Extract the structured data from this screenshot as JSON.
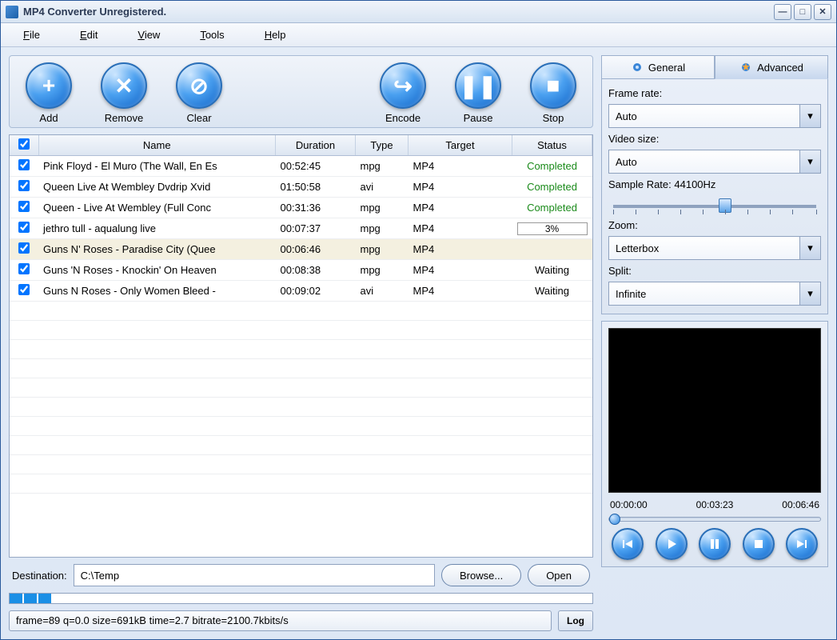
{
  "window": {
    "title": "MP4 Converter Unregistered."
  },
  "menu": {
    "file": "File",
    "edit": "Edit",
    "view": "View",
    "tools": "Tools",
    "help": "Help"
  },
  "toolbar": {
    "add": "Add",
    "remove": "Remove",
    "clear": "Clear",
    "encode": "Encode",
    "pause": "Pause",
    "stop": "Stop"
  },
  "table": {
    "headers": {
      "name": "Name",
      "duration": "Duration",
      "type": "Type",
      "target": "Target",
      "status": "Status"
    },
    "rows": [
      {
        "name": "Pink Floyd - El Muro (The Wall, En Es",
        "duration": "00:52:45",
        "type": "mpg",
        "target": "MP4",
        "status": "Completed",
        "status_kind": "complete"
      },
      {
        "name": "Queen Live At Wembley Dvdrip Xvid",
        "duration": "01:50:58",
        "type": "avi",
        "target": "MP4",
        "status": "Completed",
        "status_kind": "complete"
      },
      {
        "name": "Queen - Live At Wembley (Full Conc",
        "duration": "00:31:36",
        "type": "mpg",
        "target": "MP4",
        "status": "Completed",
        "status_kind": "complete"
      },
      {
        "name": "jethro tull - aqualung live",
        "duration": "00:07:37",
        "type": "mpg",
        "target": "MP4",
        "status": "3%",
        "status_kind": "progress"
      },
      {
        "name": "Guns N' Roses - Paradise City (Quee",
        "duration": "00:06:46",
        "type": "mpg",
        "target": "MP4",
        "status": "",
        "status_kind": "selected"
      },
      {
        "name": "Guns 'N Roses - Knockin' On Heaven",
        "duration": "00:08:38",
        "type": "mpg",
        "target": "MP4",
        "status": "Waiting",
        "status_kind": "waiting"
      },
      {
        "name": "Guns N Roses - Only Women Bleed -",
        "duration": "00:09:02",
        "type": "avi",
        "target": "MP4",
        "status": "Waiting",
        "status_kind": "waiting"
      }
    ]
  },
  "destination": {
    "label": "Destination:",
    "path": "C:\\Temp",
    "browse": "Browse...",
    "open": "Open"
  },
  "status": {
    "text": "frame=89 q=0.0 size=691kB time=2.7 bitrate=2100.7kbits/s",
    "log": "Log"
  },
  "tabs": {
    "general": "General",
    "advanced": "Advanced"
  },
  "options": {
    "frame_rate_label": "Frame rate:",
    "frame_rate_value": "Auto",
    "video_size_label": "Video size:",
    "video_size_value": "Auto",
    "sample_rate_label": "Sample Rate: 44100Hz",
    "zoom_label": "Zoom:",
    "zoom_value": "Letterbox",
    "split_label": "Split:",
    "split_value": "Infinite"
  },
  "preview": {
    "time_start": "00:00:00",
    "time_mid": "00:03:23",
    "time_end": "00:06:46"
  }
}
